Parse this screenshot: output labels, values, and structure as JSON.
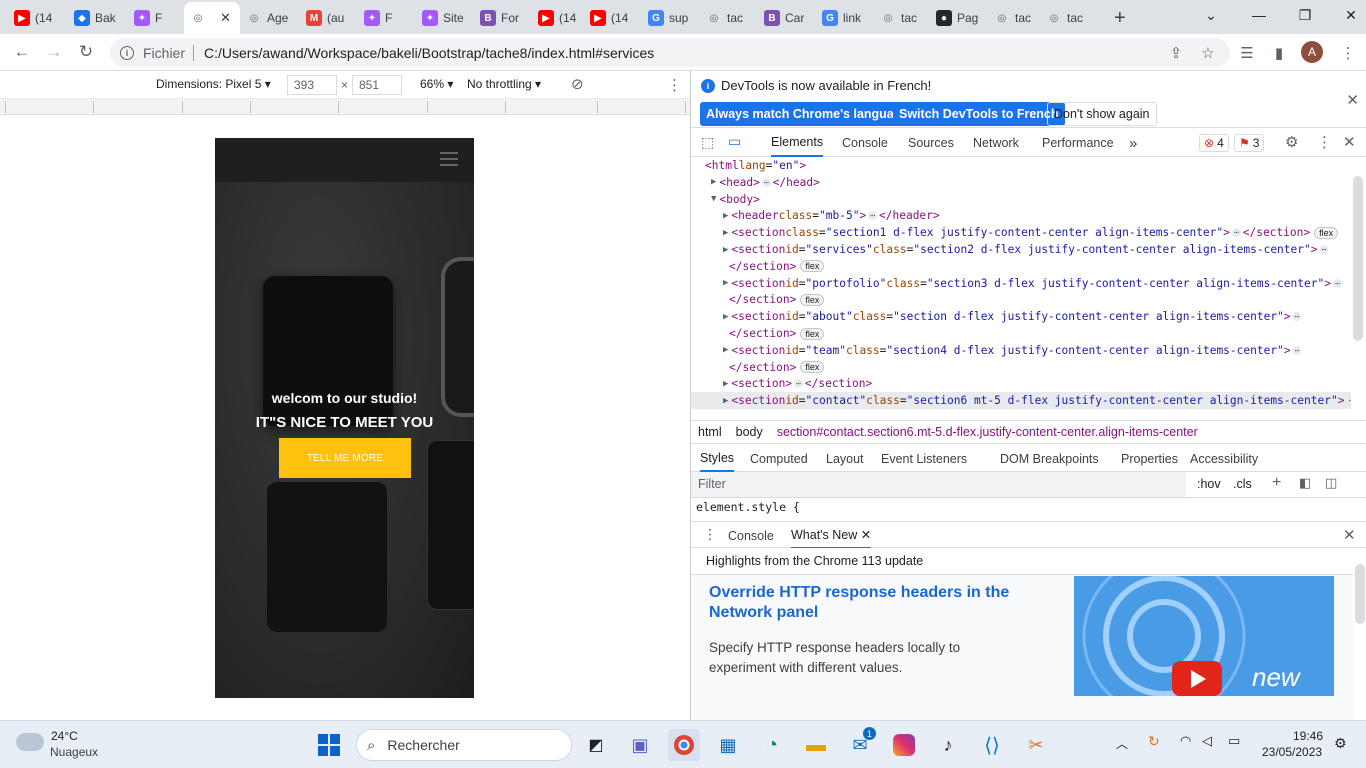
{
  "browser": {
    "tabs": [
      {
        "title": "(14",
        "icon": "youtube-icon",
        "color": "#ff0000"
      },
      {
        "title": "Bak",
        "icon": "app-icon",
        "color": "#1a73e8"
      },
      {
        "title": "F",
        "icon": "figma-icon",
        "color": "#a259ff"
      },
      {
        "title": "",
        "icon": "globe-icon",
        "color": "#5f6368"
      },
      {
        "title": "Age",
        "icon": "globe-icon",
        "color": "#5f6368"
      },
      {
        "title": "(au",
        "icon": "gmail-icon",
        "color": "#ea4335"
      },
      {
        "title": "F",
        "icon": "figma-icon",
        "color": "#a259ff"
      },
      {
        "title": "Site",
        "icon": "figma-icon",
        "color": "#a259ff"
      },
      {
        "title": "For",
        "icon": "bootstrap-icon",
        "color": "#7952b3"
      },
      {
        "title": "(14",
        "icon": "youtube-icon",
        "color": "#ff0000"
      },
      {
        "title": "(14",
        "icon": "youtube-icon",
        "color": "#ff0000"
      },
      {
        "title": "sup",
        "icon": "google-icon",
        "color": "#4285f4"
      },
      {
        "title": "tac",
        "icon": "globe-icon",
        "color": "#5f6368"
      },
      {
        "title": "Car",
        "icon": "bootstrap-icon",
        "color": "#7952b3"
      },
      {
        "title": "link",
        "icon": "google-icon",
        "color": "#4285f4"
      },
      {
        "title": "tac",
        "icon": "globe-icon",
        "color": "#5f6368"
      },
      {
        "title": "Pag",
        "icon": "github-icon",
        "color": "#24292f"
      },
      {
        "title": "tac",
        "icon": "globe-icon",
        "color": "#5f6368"
      },
      {
        "title": "tac",
        "icon": "globe-icon",
        "color": "#5f6368"
      }
    ],
    "new_tab": "+",
    "scheme_label": "Fichier",
    "url": "C:/Users/awand/Workspace/bakeli/Bootstrap/tache8/index.html#services",
    "profile_initial": "A"
  },
  "device_toolbar": {
    "dimensions_label": "Dimensions: Pixel 5",
    "width": "393",
    "times": "×",
    "height": "851",
    "zoom": "66%",
    "throttling": "No throttling"
  },
  "page": {
    "hero_line1": "welcom to our studio!",
    "hero_line2": "IT\"S NICE TO MEET YOU",
    "cta_label": "TELL ME MORE"
  },
  "devtools": {
    "info_message": "DevTools is now available in French!",
    "btn_match": "Always match Chrome's language",
    "btn_switch": "Switch DevTools to French",
    "btn_dismiss": "Don't show again",
    "tabs": [
      "Elements",
      "Console",
      "Sources",
      "Network",
      "Performance"
    ],
    "more_tabs": "»",
    "error_count": "4",
    "issue_count": "3",
    "tree": [
      {
        "indent": 14,
        "arrow": "",
        "html": "html_open"
      },
      {
        "indent": 20,
        "arrow": "▶",
        "html": "head"
      },
      {
        "indent": 20,
        "arrow": "▼",
        "html": "body_open"
      },
      {
        "indent": 32,
        "arrow": "▶",
        "html": "header"
      },
      {
        "indent": 32,
        "arrow": "▶",
        "html": "section1"
      },
      {
        "indent": 32,
        "arrow": "▶",
        "html": "services"
      },
      {
        "indent": 38,
        "arrow": "",
        "html": "close_flex"
      },
      {
        "indent": 32,
        "arrow": "▶",
        "html": "portofolio"
      },
      {
        "indent": 38,
        "arrow": "",
        "html": "close_flex"
      },
      {
        "indent": 32,
        "arrow": "▶",
        "html": "about"
      },
      {
        "indent": 38,
        "arrow": "",
        "html": "close_flex"
      },
      {
        "indent": 32,
        "arrow": "▶",
        "html": "team"
      },
      {
        "indent": 38,
        "arrow": "",
        "html": "close_flex"
      },
      {
        "indent": 32,
        "arrow": "▶",
        "html": "section_plain"
      },
      {
        "indent": 32,
        "arrow": "▶",
        "html": "contact"
      }
    ],
    "breadcrumbs": [
      "html",
      "body",
      "section#contact.section6.mt-5.d-flex.justify-content-center.align-items-center"
    ],
    "style_tabs": [
      "Styles",
      "Computed",
      "Layout",
      "Event Listeners",
      "DOM Breakpoints",
      "Properties",
      "Accessibility"
    ],
    "filter_placeholder": "Filter",
    "hov": ":hov",
    "cls": ".cls",
    "element_style": "element.style {",
    "drawer_tabs": [
      "Console",
      "What's New"
    ],
    "whats_new_header": "Highlights from the Chrome 113 update",
    "whats_new_title": "Override HTTP response headers in the Network panel",
    "whats_new_desc": "Specify HTTP response headers locally to experiment with different values.",
    "whats_new_badge": "new"
  },
  "taskbar": {
    "weather_temp": "24°C",
    "weather_desc": "Nuageux",
    "search_placeholder": "Rechercher",
    "time": "19:46",
    "date": "23/05/2023",
    "mail_badge": "1"
  }
}
